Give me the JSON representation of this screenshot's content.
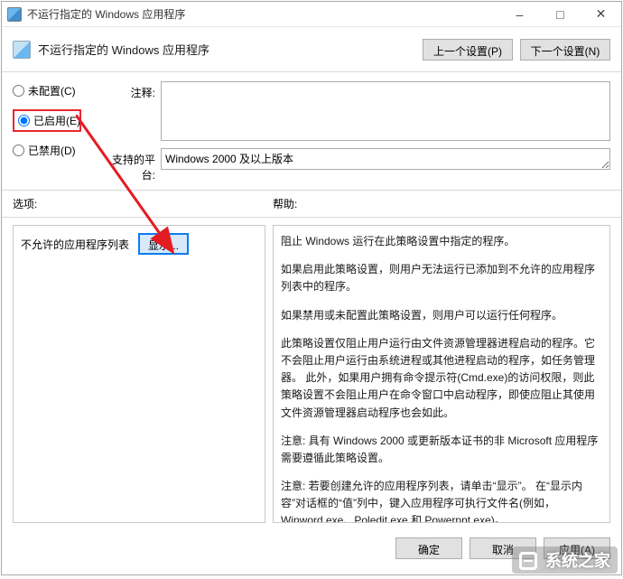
{
  "window": {
    "title": "不运行指定的 Windows 应用程序"
  },
  "header": {
    "title": "不运行指定的 Windows 应用程序",
    "prev_btn": "上一个设置(P)",
    "next_btn": "下一个设置(N)"
  },
  "radios": {
    "not_configured": "未配置(C)",
    "enabled": "已启用(E)",
    "disabled": "已禁用(D)",
    "selected": "enabled"
  },
  "fields": {
    "comment_label": "注释:",
    "comment_value": "",
    "platform_label": "支持的平台:",
    "platform_value": "Windows 2000 及以上版本"
  },
  "midbar": {
    "options_label": "选项:",
    "help_label": "帮助:"
  },
  "options_pane": {
    "list_label": "不允许的应用程序列表",
    "show_btn": "显示..."
  },
  "help_pane": {
    "paragraphs": [
      "阻止 Windows 运行在此策略设置中指定的程序。",
      "如果启用此策略设置，则用户无法运行已添加到不允许的应用程序列表中的程序。",
      "如果禁用或未配置此策略设置，则用户可以运行任何程序。",
      "此策略设置仅阻止用户运行由文件资源管理器进程启动的程序。它不会阻止用户运行由系统进程或其他进程启动的程序，如任务管理器。  此外，如果用户拥有命令提示符(Cmd.exe)的访问权限，则此策略设置不会阻止用户在命令窗口中启动程序，即使应阻止其使用文件资源管理器启动程序也会如此。",
      "注意: 具有 Windows 2000 或更新版本证书的非 Microsoft 应用程序需要遵循此策略设置。",
      "注意: 若要创建允许的应用程序列表，请单击“显示”。  在“显示内容”对话框的“值”列中，键入应用程序可执行文件名(例如，Winword.exe、Poledit.exe 和 Powerpnt.exe)。"
    ]
  },
  "footer": {
    "ok": "确定",
    "cancel": "取消",
    "apply": "应用(A)"
  },
  "watermark": "系统之家"
}
